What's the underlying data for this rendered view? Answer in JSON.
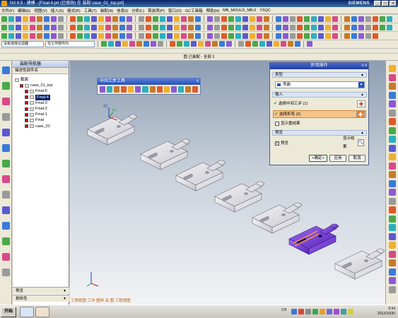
{
  "window": {
    "title": "NX 6.5 - 建模 - [Final-4.prt  (已修改)  在 装配  case_01_top.prt]",
    "brand": "SIEMENS",
    "minimize": "_",
    "restore": "□",
    "close": "x"
  },
  "menubar": [
    "文件(F)",
    "编辑(E)",
    "视图(V)",
    "插入(S)",
    "格式(R)",
    "工具(T)",
    "装配(A)",
    "信息(I)",
    "分析(L)",
    "首选项(P)",
    "窗口(O)",
    "GC工具箱",
    "帮助(H)",
    "MB_MOULD_MB.6",
    "YSQC"
  ],
  "toolbar": {
    "selection_filter": "没有选择过滤器",
    "scope_filter": "在工作部件内"
  },
  "viewport": {
    "title": "图 已装配 - 全部 2"
  },
  "navigator": {
    "title": "装配导航器",
    "column_header": "描述性部件名",
    "nodes": [
      {
        "label": "截面",
        "indent": 0,
        "checked": false,
        "selected": false
      },
      {
        "label": "case_01_top",
        "indent": 1,
        "checked": true,
        "selected": false
      },
      {
        "label": "Final-5",
        "indent": 2,
        "checked": true,
        "selected": false
      },
      {
        "label": "Final-4",
        "indent": 2,
        "checked": true,
        "selected": true
      },
      {
        "label": "Final-3",
        "indent": 2,
        "checked": true,
        "selected": false
      },
      {
        "label": "Final-2",
        "indent": 2,
        "checked": true,
        "selected": false
      },
      {
        "label": "Final-1",
        "indent": 2,
        "checked": true,
        "selected": false
      },
      {
        "label": "Final",
        "indent": 2,
        "checked": true,
        "selected": false
      },
      {
        "label": "case_01",
        "indent": 2,
        "checked": true,
        "selected": false
      }
    ],
    "footer_preview": "预览",
    "footer_dependency": "相依性"
  },
  "process_toolbar": {
    "title": "中间工步工具",
    "close": "x"
  },
  "dialog": {
    "title": "折弯操作",
    "controls": "ↄ x",
    "type_section": "类型",
    "type_value": "弯曲",
    "input_section": "输入",
    "row1_label": "选择中间工步 (1)",
    "row2_label": "选择折弯 (2)",
    "show_checkbox_label": "显示重结果",
    "preview_section": "预览",
    "preview_checkbox_label": "预览",
    "show_result_label": "显示结果",
    "ok": "<确定>",
    "apply": "应用",
    "cancel": "取消"
  },
  "status_line": "工程视图 工作 图样 关 图 工程视图",
  "taskbar": {
    "start": "开始",
    "tray_lang": "CH",
    "time": "9:34",
    "date": "2012/10/30"
  },
  "colors": {
    "selected_part": "#7a3fd6",
    "highlight_row": "#f6c48a"
  }
}
